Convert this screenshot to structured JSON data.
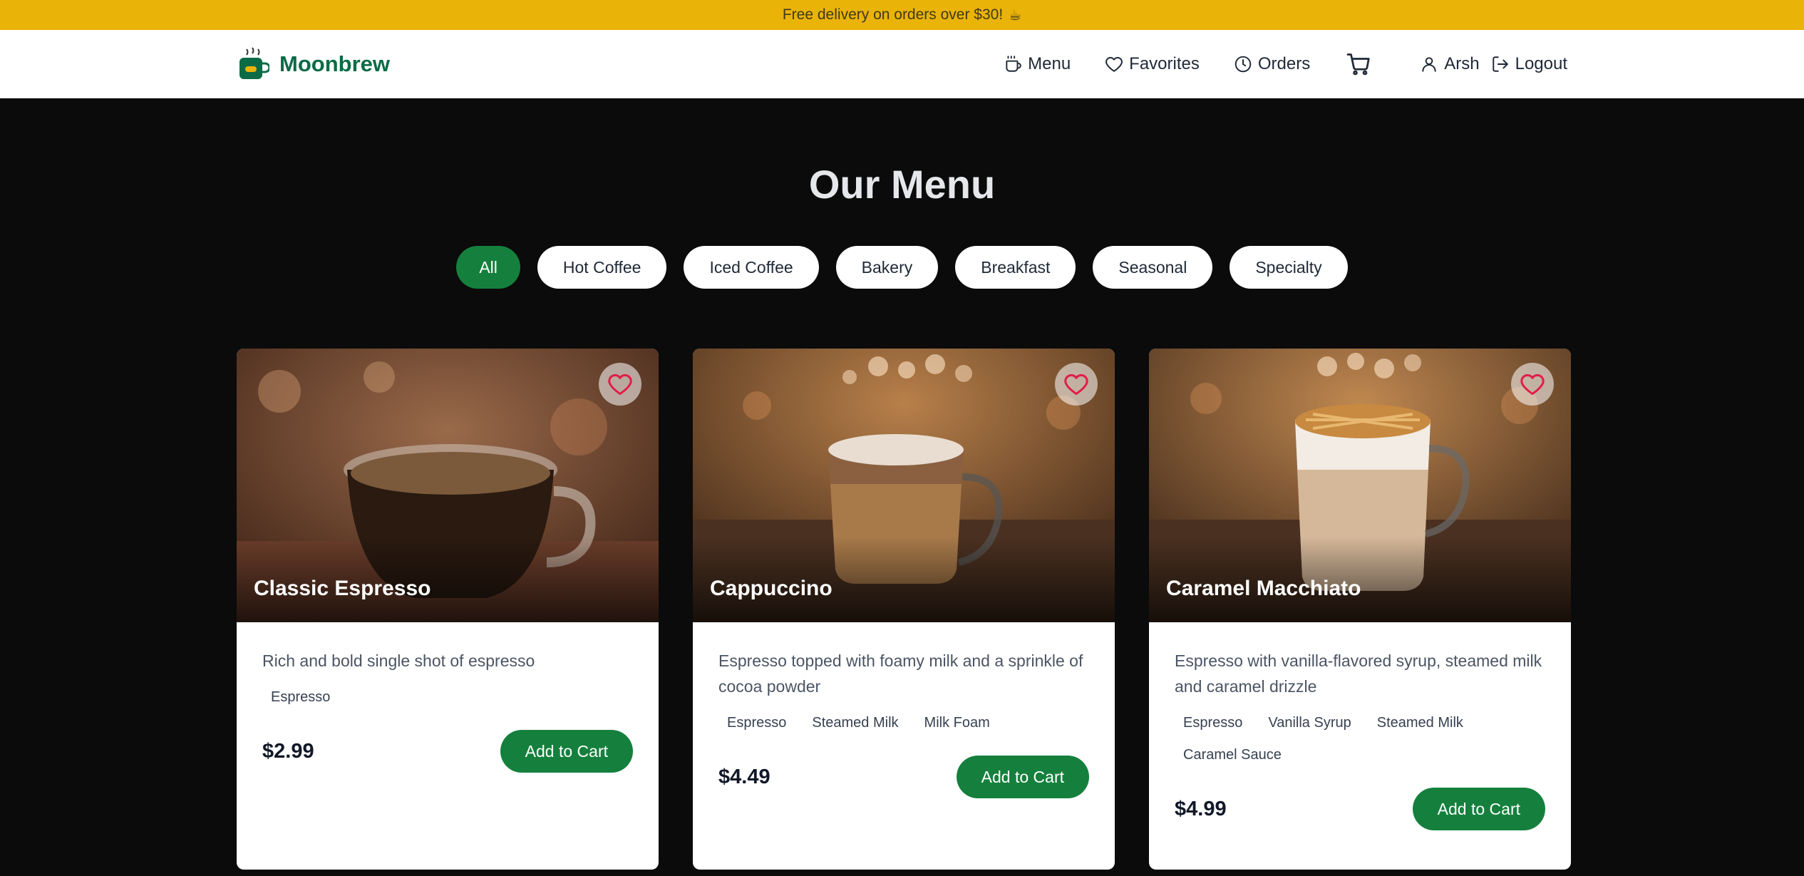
{
  "promo": {
    "text": "Free delivery on orders over $30!",
    "icon": "coffee-cup-emoji",
    "emoji": "☕"
  },
  "header": {
    "brand": "Moonbrew",
    "nav": [
      {
        "label": "Menu",
        "icon": "coffee-icon"
      },
      {
        "label": "Favorites",
        "icon": "heart-icon"
      },
      {
        "label": "Orders",
        "icon": "clock-icon"
      }
    ],
    "cart_icon": "cart-icon",
    "user": {
      "label": "Arsh",
      "icon": "user-icon"
    },
    "logout": {
      "label": "Logout",
      "icon": "logout-icon"
    }
  },
  "main": {
    "title": "Our Menu",
    "filters": [
      "All",
      "Hot Coffee",
      "Iced Coffee",
      "Bakery",
      "Breakfast",
      "Seasonal",
      "Specialty"
    ],
    "active_filter": "All",
    "products": [
      {
        "name": "Classic Espresso",
        "description": "Rich and bold single shot of espresso",
        "ingredients": [
          "Espresso"
        ],
        "price": "$2.99",
        "button": "Add to Cart"
      },
      {
        "name": "Cappuccino",
        "description": "Espresso topped with foamy milk and a sprinkle of cocoa powder",
        "ingredients": [
          "Espresso",
          "Steamed Milk",
          "Milk Foam"
        ],
        "price": "$4.49",
        "button": "Add to Cart"
      },
      {
        "name": "Caramel Macchiato",
        "description": "Espresso with vanilla-flavored syrup, steamed milk and caramel drizzle",
        "ingredients": [
          "Espresso",
          "Vanilla Syrup",
          "Steamed Milk",
          "Caramel Sauce"
        ],
        "price": "$4.99",
        "button": "Add to Cart"
      }
    ]
  },
  "colors": {
    "brand": "#0b6b47",
    "accent": "#15803d",
    "promo_bg": "#eab308",
    "heart": "#e11d48"
  }
}
